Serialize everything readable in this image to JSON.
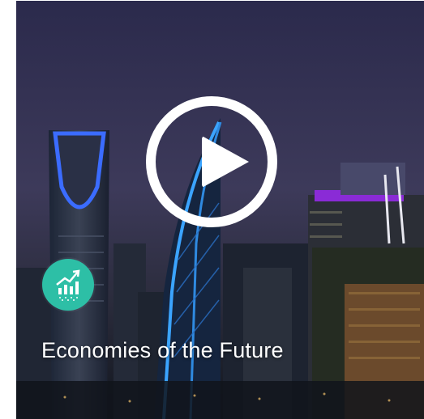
{
  "card": {
    "title": "Economies of the Future",
    "play_icon": "play-circle-icon",
    "badge_icon": "growth-chart-icon",
    "accent_color": "#2dbfa6"
  }
}
